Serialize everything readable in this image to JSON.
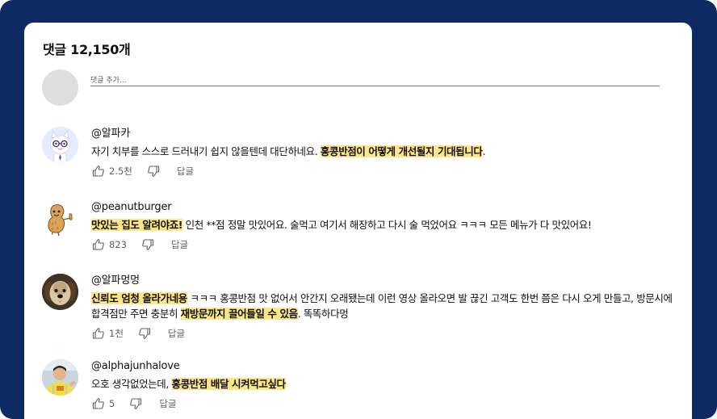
{
  "header": {
    "count_label": "댓글 12,150개"
  },
  "compose": {
    "placeholder": "댓글 추가..."
  },
  "reply_label": "답글",
  "comments": [
    {
      "handle": "@알파카",
      "text_parts": [
        {
          "text": "자기 치부를 스스로 드러내기 쉽지 않을텐데 대단하네요. ",
          "highlight": false
        },
        {
          "text": "홍콩반점이 어떻게 개선될지 기대됩니다",
          "highlight": true
        },
        {
          "text": ".",
          "highlight": false
        }
      ],
      "likes": "2.5천",
      "avatar_icon": "alpaca-avatar-icon"
    },
    {
      "handle": "@peanutburger",
      "text_parts": [
        {
          "text": "맛있는 집도 알려야죠!",
          "highlight": true
        },
        {
          "text": " 인천 **점 정말 맛있어요. 술먹고 여기서 해장하고 다시 술 먹었어요 ㅋㅋㅋ 모든 메뉴가 다 맛있어요!",
          "highlight": false
        }
      ],
      "likes": "823",
      "avatar_icon": "peanut-avatar-icon"
    },
    {
      "handle": "@알파멍멍",
      "text_parts": [
        {
          "text": "신뢰도 엄청 올라가네용",
          "highlight": true
        },
        {
          "text": " ㅋㅋㅋ 홍콩반점 맛 없어서 안간지 오래됐는데 이런 영상 올라오면 발 끊긴 고객도 한번 쯤은 다시 오게 만들고, 방문시에 합격점만 주면 충분히 ",
          "highlight": false
        },
        {
          "text": "재방문까지 끌어들일 수 있음",
          "highlight": true
        },
        {
          "text": ". 똑똑하다멍",
          "highlight": false
        }
      ],
      "likes": "1천",
      "avatar_icon": "dog-avatar-icon"
    },
    {
      "handle": "@alphajunhalove",
      "text_parts": [
        {
          "text": "오호 생각없었는데, ",
          "highlight": false
        },
        {
          "text": "홍콩반점 배달 시켜먹고싶다",
          "highlight": true
        }
      ],
      "likes": "5",
      "avatar_icon": "person-avatar-icon"
    }
  ],
  "colors": {
    "frame": "#0d2a63",
    "highlight": "#fde68a",
    "muted_text": "#606060",
    "placeholder_avatar": "#dedede"
  }
}
